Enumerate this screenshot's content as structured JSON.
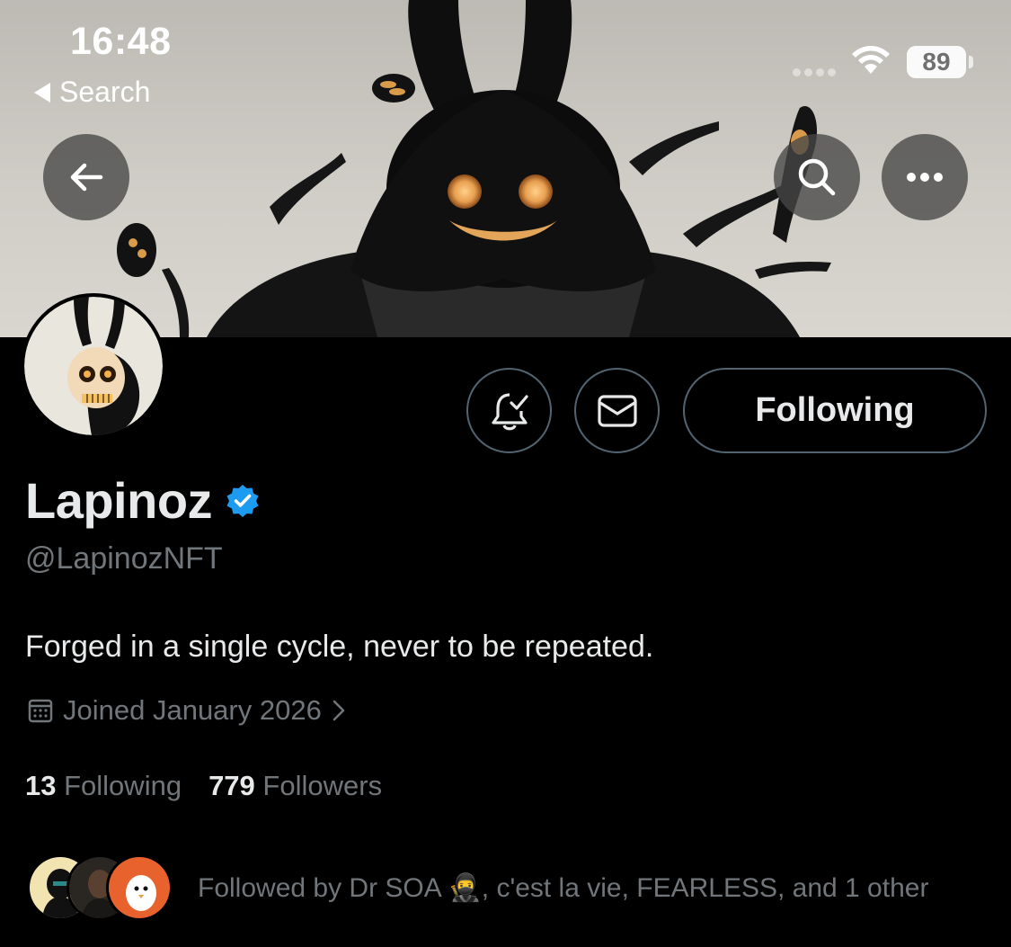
{
  "status_bar": {
    "time": "16:48",
    "back_label": "Search",
    "battery": "89"
  },
  "nav": {
    "back_icon": "arrow-left-icon",
    "search_icon": "search-icon",
    "more_icon": "more-horizontal-icon"
  },
  "profile": {
    "name": "Lapinoz",
    "handle": "@LapinozNFT",
    "bio": "Forged in a single cycle, never to be repeated.",
    "joined": "Joined January 2026",
    "following_count": "13",
    "following_label": "Following",
    "followers_count": "779",
    "followers_label": "Followers",
    "verified_color": "#1d9bf0"
  },
  "actions": {
    "follow_button": "Following",
    "notify_icon": "bell-check-icon",
    "message_icon": "envelope-icon"
  },
  "followed_by": {
    "text": "Followed by Dr SOA 🥷, c'est la vie, FEARLESS, and 1 other"
  },
  "colors": {
    "background": "#000000",
    "text": "#e7e9ea",
    "muted": "#71767b",
    "border": "#536471"
  }
}
